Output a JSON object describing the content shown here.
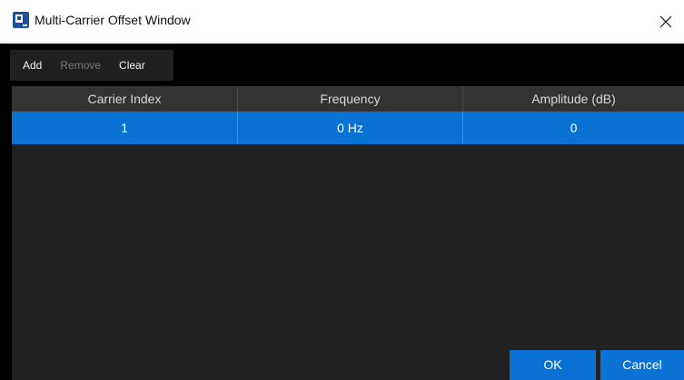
{
  "window": {
    "title": "Multi-Carrier Offset Window",
    "icon": "app-icon",
    "close_icon": "close-icon"
  },
  "toolbar": {
    "add_label": "Add",
    "remove_label": "Remove",
    "clear_label": "Clear",
    "remove_enabled": false
  },
  "table": {
    "columns": [
      "Carrier Index",
      "Frequency",
      "Amplitude (dB)"
    ],
    "rows": [
      {
        "index": "1",
        "frequency": "0 Hz",
        "amplitude": "0",
        "selected": true
      }
    ]
  },
  "buttons": {
    "ok_label": "OK",
    "cancel_label": "Cancel"
  },
  "colors": {
    "accent": "#0a72d4",
    "background": "#000000",
    "table_background": "#222222",
    "header_background": "#333333",
    "disabled_text": "#7a7a7a"
  }
}
